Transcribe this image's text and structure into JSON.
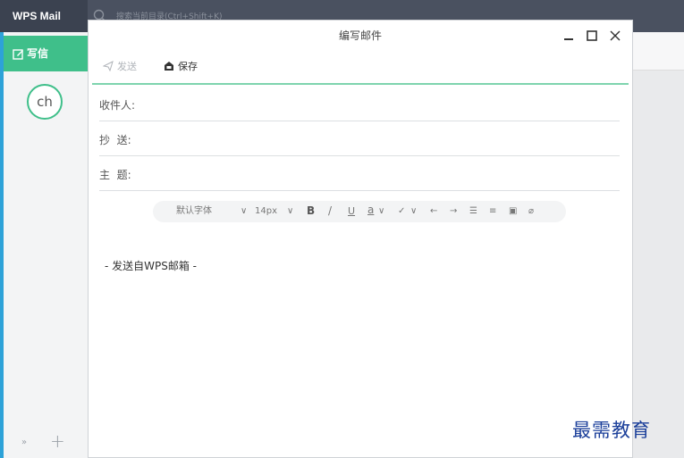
{
  "app": {
    "name": "WPS Mail"
  },
  "search": {
    "placeholder": "搜索当前目录(Ctrl+Shift+K)"
  },
  "sidebar": {
    "compose_label": "写信",
    "avatar_text": "ch",
    "collapse_icon": "»",
    "add_icon": "+"
  },
  "window": {
    "title": "编写邮件",
    "controls": [
      "minimize-icon",
      "maximize-icon",
      "close-icon"
    ]
  },
  "toolbar": {
    "send_label": "发送",
    "save_label": "保存"
  },
  "fields": {
    "to_label": "收件人:",
    "cc_label": "抄  送:",
    "subject_label": "主  题:",
    "to_value": "",
    "cc_value": "",
    "subject_value": ""
  },
  "format_bar": {
    "font": "默认字体",
    "font_size": "14px",
    "bold": "B",
    "italic": "/",
    "underline": "U",
    "font_color": "a",
    "icons": [
      "highlight-icon",
      "undo-icon",
      "redo-icon",
      "align-icon",
      "list-icon",
      "image-icon",
      "attach-icon"
    ]
  },
  "body": {
    "signature": "- 发送自WPS邮箱 -"
  },
  "watermark": "最需教育",
  "colors": {
    "accent": "#3fbf8a",
    "topbar": "#4a5160",
    "sidebar_stripe": "#2da2d8",
    "watermark": "#1b3f9a"
  }
}
